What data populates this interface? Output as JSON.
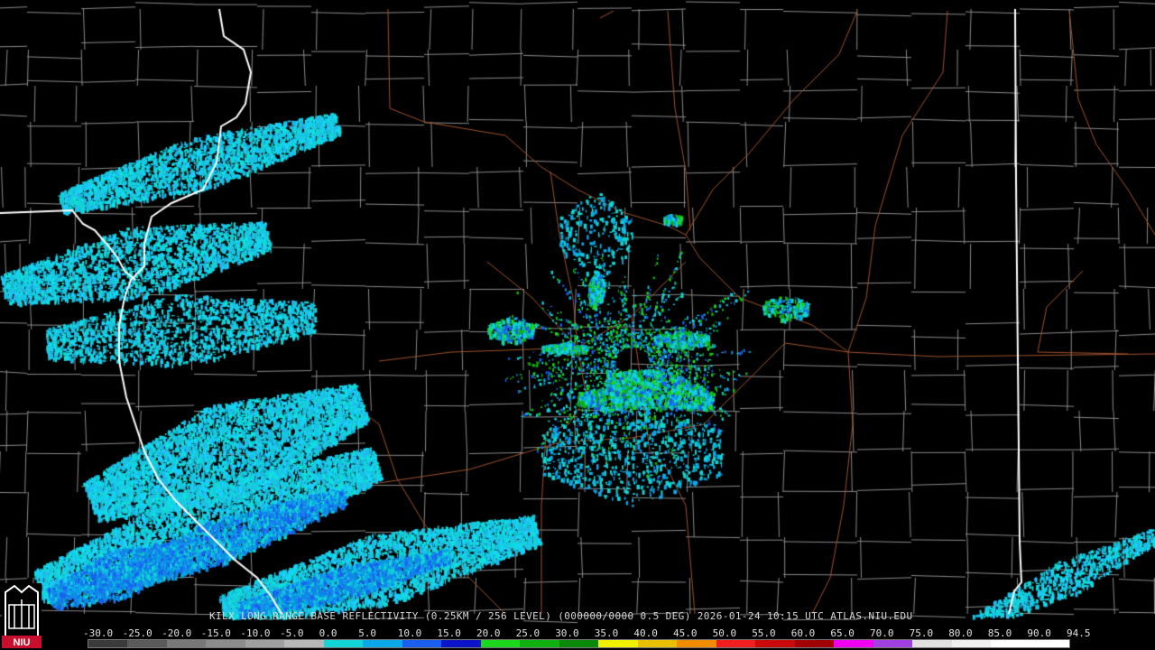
{
  "product_title": "KILX LONG RANGE BASE REFLECTIVITY (0.25KM / 256 LEVEL) (000000/0000 0.5 DEG) 2026-01-24 10:15 UTC  ATLAS.NIU.EDU",
  "logo_text": "NIU",
  "color_scale": {
    "labels": [
      "-30.0",
      "-25.0",
      "-20.0",
      "-15.0",
      "-10.0",
      "-5.0",
      "0.0",
      "5.0",
      "10.0",
      "15.0",
      "20.0",
      "25.0",
      "30.0",
      "35.0",
      "40.0",
      "45.0",
      "50.0",
      "55.0",
      "60.0",
      "65.0",
      "70.0",
      "75.0",
      "80.0",
      "85.0",
      "90.0",
      "94.5"
    ],
    "colors": [
      "#3a3a3a",
      "#5a5a5a",
      "#787878",
      "#8c8c8c",
      "#a0a0a0",
      "#b8b8b8",
      "#12d5d5",
      "#0aa8e8",
      "#1a5ef0",
      "#0a14c8",
      "#1cd81c",
      "#0fb00f",
      "#0a880a",
      "#f0f000",
      "#e8c000",
      "#f08c00",
      "#f01e1e",
      "#c80a0a",
      "#a00000",
      "#f000f0",
      "#a040e0",
      "#e0e0e0",
      "#f0f0f0",
      "#ffffff",
      "#ffffff"
    ]
  },
  "map_layers": [
    "county-borders",
    "state-borders",
    "highways",
    "radar-reflectivity"
  ]
}
